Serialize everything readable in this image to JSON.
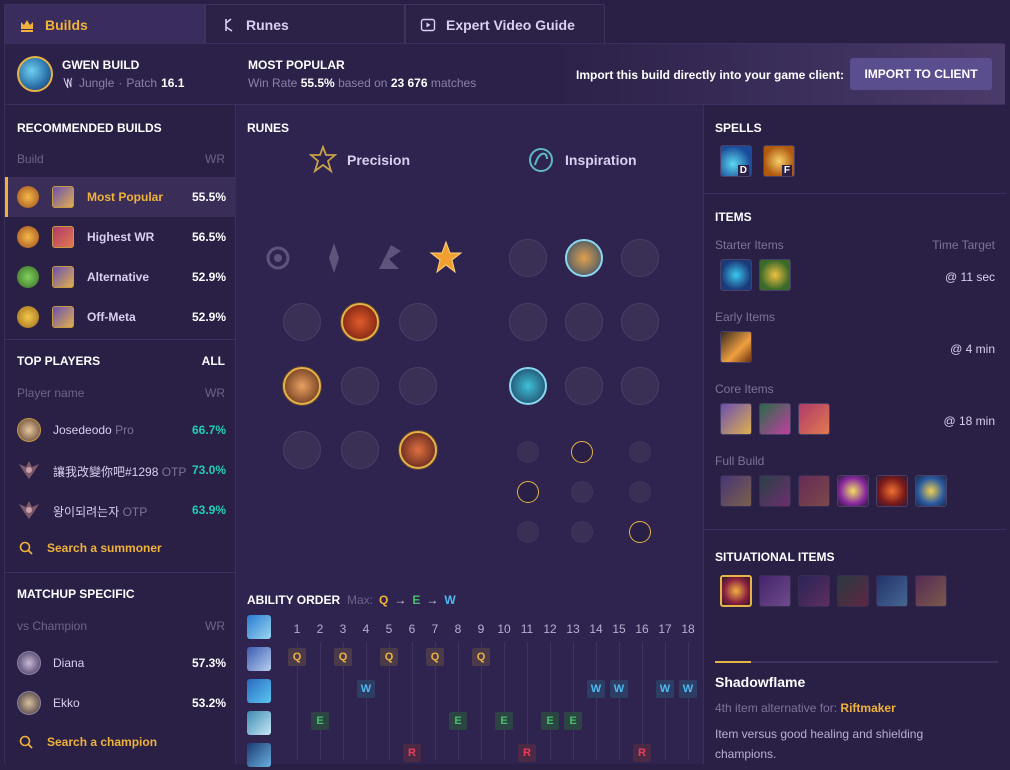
{
  "tabs": [
    {
      "label": "Builds",
      "icon": "crown-icon",
      "active": true
    },
    {
      "label": "Runes",
      "icon": "runes-icon",
      "active": false
    },
    {
      "label": "Expert Video Guide",
      "icon": "play-icon",
      "active": false
    }
  ],
  "header": {
    "build_title": "GWEN BUILD",
    "role": "Jungle",
    "patch_label": "Patch",
    "patch": "16.1",
    "mp_title": "MOST POPULAR",
    "mp_winrate_label": "Win Rate",
    "mp_winrate": "55.5%",
    "mp_based_on": "based on",
    "mp_matches": "23 676",
    "mp_matches_label": "matches",
    "import_text": "Import this build directly into your game client:",
    "import_button": "IMPORT TO CLIENT"
  },
  "recommended": {
    "title": "RECOMMENDED BUILDS",
    "col_build": "Build",
    "col_wr": "WR",
    "rows": [
      {
        "label": "Most Popular",
        "wr": "55.5%",
        "selected": true
      },
      {
        "label": "Highest WR",
        "wr": "56.5%",
        "selected": false
      },
      {
        "label": "Alternative",
        "wr": "52.9%",
        "selected": false
      },
      {
        "label": "Off-Meta",
        "wr": "52.9%",
        "selected": false
      }
    ]
  },
  "top_players": {
    "title": "TOP PLAYERS",
    "all_link": "ALL",
    "col_name": "Player name",
    "col_wr": "WR",
    "rows": [
      {
        "name": "Josedeodo",
        "tag": "Pro",
        "wr": "66.7%"
      },
      {
        "name": "讓我改變你吧#1298",
        "tag": "OTP",
        "wr": "73.0%"
      },
      {
        "name": "왕이되려는자",
        "tag": "OTP",
        "wr": "63.9%"
      }
    ],
    "search": "Search a summoner"
  },
  "matchup": {
    "title": "MATCHUP SPECIFIC",
    "col_vs": "vs Champion",
    "col_wr": "WR",
    "rows": [
      {
        "name": "Diana",
        "wr": "57.3%"
      },
      {
        "name": "Ekko",
        "wr": "53.2%"
      }
    ],
    "search": "Search a champion"
  },
  "runes": {
    "title": "RUNES",
    "primary": "Precision",
    "secondary": "Inspiration"
  },
  "ability_order": {
    "title": "ABILITY ORDER",
    "max_label": "Max:",
    "max_order": [
      "Q",
      "E",
      "W"
    ],
    "levels": [
      "1",
      "2",
      "3",
      "4",
      "5",
      "6",
      "7",
      "8",
      "9",
      "10",
      "11",
      "12",
      "13",
      "14",
      "15",
      "16",
      "17",
      "18"
    ],
    "sequence": [
      "Q",
      "E",
      "Q",
      "W",
      "Q",
      "R",
      "Q",
      "E",
      "Q",
      "E",
      "R",
      "E",
      "E",
      "W",
      "W",
      "R",
      "W",
      "W"
    ]
  },
  "spells": {
    "title": "SPELLS",
    "keys": [
      "D",
      "F"
    ]
  },
  "items": {
    "title": "ITEMS",
    "starter_label": "Starter Items",
    "time_target_label": "Time Target",
    "starter_time": "@ 11 sec",
    "early_label": "Early Items",
    "early_time": "@ 4 min",
    "core_label": "Core Items",
    "core_time": "@ 18 min",
    "full_label": "Full Build"
  },
  "situational": {
    "title": "SITUATIONAL ITEMS",
    "selected_name": "Shadowflame",
    "alt_label": "4th item alternative for:",
    "alt_item": "Riftmaker",
    "description": "Item versus good healing and shielding champions."
  },
  "colors": {
    "accent": "#f0b23a",
    "winrate_high": "#1fcfb4",
    "q": "#f0b23a",
    "w": "#4fb9f0",
    "e": "#45c06a",
    "r": "#ee3b5a"
  }
}
